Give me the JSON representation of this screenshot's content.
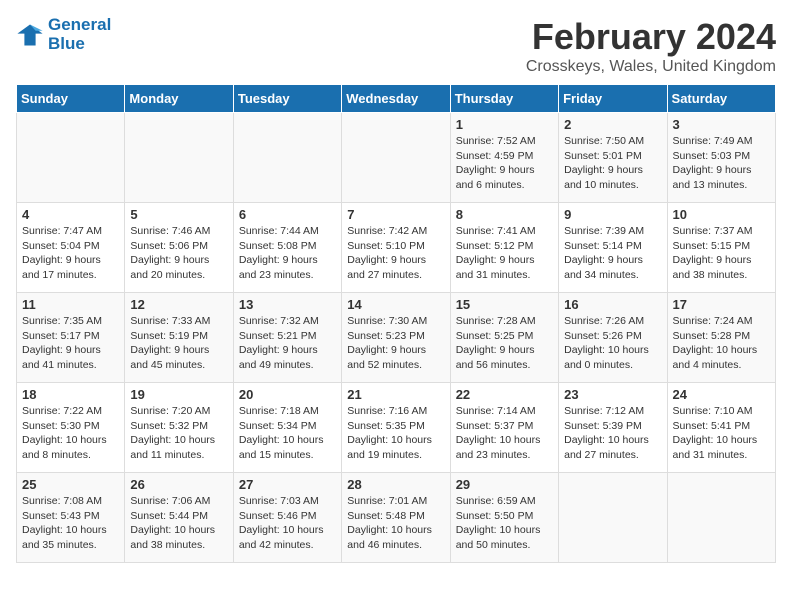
{
  "header": {
    "logo_line1": "General",
    "logo_line2": "Blue",
    "month_title": "February 2024",
    "location": "Crosskeys, Wales, United Kingdom"
  },
  "weekdays": [
    "Sunday",
    "Monday",
    "Tuesday",
    "Wednesday",
    "Thursday",
    "Friday",
    "Saturday"
  ],
  "weeks": [
    [
      {
        "day": "",
        "info": ""
      },
      {
        "day": "",
        "info": ""
      },
      {
        "day": "",
        "info": ""
      },
      {
        "day": "",
        "info": ""
      },
      {
        "day": "1",
        "info": "Sunrise: 7:52 AM\nSunset: 4:59 PM\nDaylight: 9 hours\nand 6 minutes."
      },
      {
        "day": "2",
        "info": "Sunrise: 7:50 AM\nSunset: 5:01 PM\nDaylight: 9 hours\nand 10 minutes."
      },
      {
        "day": "3",
        "info": "Sunrise: 7:49 AM\nSunset: 5:03 PM\nDaylight: 9 hours\nand 13 minutes."
      }
    ],
    [
      {
        "day": "4",
        "info": "Sunrise: 7:47 AM\nSunset: 5:04 PM\nDaylight: 9 hours\nand 17 minutes."
      },
      {
        "day": "5",
        "info": "Sunrise: 7:46 AM\nSunset: 5:06 PM\nDaylight: 9 hours\nand 20 minutes."
      },
      {
        "day": "6",
        "info": "Sunrise: 7:44 AM\nSunset: 5:08 PM\nDaylight: 9 hours\nand 23 minutes."
      },
      {
        "day": "7",
        "info": "Sunrise: 7:42 AM\nSunset: 5:10 PM\nDaylight: 9 hours\nand 27 minutes."
      },
      {
        "day": "8",
        "info": "Sunrise: 7:41 AM\nSunset: 5:12 PM\nDaylight: 9 hours\nand 31 minutes."
      },
      {
        "day": "9",
        "info": "Sunrise: 7:39 AM\nSunset: 5:14 PM\nDaylight: 9 hours\nand 34 minutes."
      },
      {
        "day": "10",
        "info": "Sunrise: 7:37 AM\nSunset: 5:15 PM\nDaylight: 9 hours\nand 38 minutes."
      }
    ],
    [
      {
        "day": "11",
        "info": "Sunrise: 7:35 AM\nSunset: 5:17 PM\nDaylight: 9 hours\nand 41 minutes."
      },
      {
        "day": "12",
        "info": "Sunrise: 7:33 AM\nSunset: 5:19 PM\nDaylight: 9 hours\nand 45 minutes."
      },
      {
        "day": "13",
        "info": "Sunrise: 7:32 AM\nSunset: 5:21 PM\nDaylight: 9 hours\nand 49 minutes."
      },
      {
        "day": "14",
        "info": "Sunrise: 7:30 AM\nSunset: 5:23 PM\nDaylight: 9 hours\nand 52 minutes."
      },
      {
        "day": "15",
        "info": "Sunrise: 7:28 AM\nSunset: 5:25 PM\nDaylight: 9 hours\nand 56 minutes."
      },
      {
        "day": "16",
        "info": "Sunrise: 7:26 AM\nSunset: 5:26 PM\nDaylight: 10 hours\nand 0 minutes."
      },
      {
        "day": "17",
        "info": "Sunrise: 7:24 AM\nSunset: 5:28 PM\nDaylight: 10 hours\nand 4 minutes."
      }
    ],
    [
      {
        "day": "18",
        "info": "Sunrise: 7:22 AM\nSunset: 5:30 PM\nDaylight: 10 hours\nand 8 minutes."
      },
      {
        "day": "19",
        "info": "Sunrise: 7:20 AM\nSunset: 5:32 PM\nDaylight: 10 hours\nand 11 minutes."
      },
      {
        "day": "20",
        "info": "Sunrise: 7:18 AM\nSunset: 5:34 PM\nDaylight: 10 hours\nand 15 minutes."
      },
      {
        "day": "21",
        "info": "Sunrise: 7:16 AM\nSunset: 5:35 PM\nDaylight: 10 hours\nand 19 minutes."
      },
      {
        "day": "22",
        "info": "Sunrise: 7:14 AM\nSunset: 5:37 PM\nDaylight: 10 hours\nand 23 minutes."
      },
      {
        "day": "23",
        "info": "Sunrise: 7:12 AM\nSunset: 5:39 PM\nDaylight: 10 hours\nand 27 minutes."
      },
      {
        "day": "24",
        "info": "Sunrise: 7:10 AM\nSunset: 5:41 PM\nDaylight: 10 hours\nand 31 minutes."
      }
    ],
    [
      {
        "day": "25",
        "info": "Sunrise: 7:08 AM\nSunset: 5:43 PM\nDaylight: 10 hours\nand 35 minutes."
      },
      {
        "day": "26",
        "info": "Sunrise: 7:06 AM\nSunset: 5:44 PM\nDaylight: 10 hours\nand 38 minutes."
      },
      {
        "day": "27",
        "info": "Sunrise: 7:03 AM\nSunset: 5:46 PM\nDaylight: 10 hours\nand 42 minutes."
      },
      {
        "day": "28",
        "info": "Sunrise: 7:01 AM\nSunset: 5:48 PM\nDaylight: 10 hours\nand 46 minutes."
      },
      {
        "day": "29",
        "info": "Sunrise: 6:59 AM\nSunset: 5:50 PM\nDaylight: 10 hours\nand 50 minutes."
      },
      {
        "day": "",
        "info": ""
      },
      {
        "day": "",
        "info": ""
      }
    ]
  ]
}
